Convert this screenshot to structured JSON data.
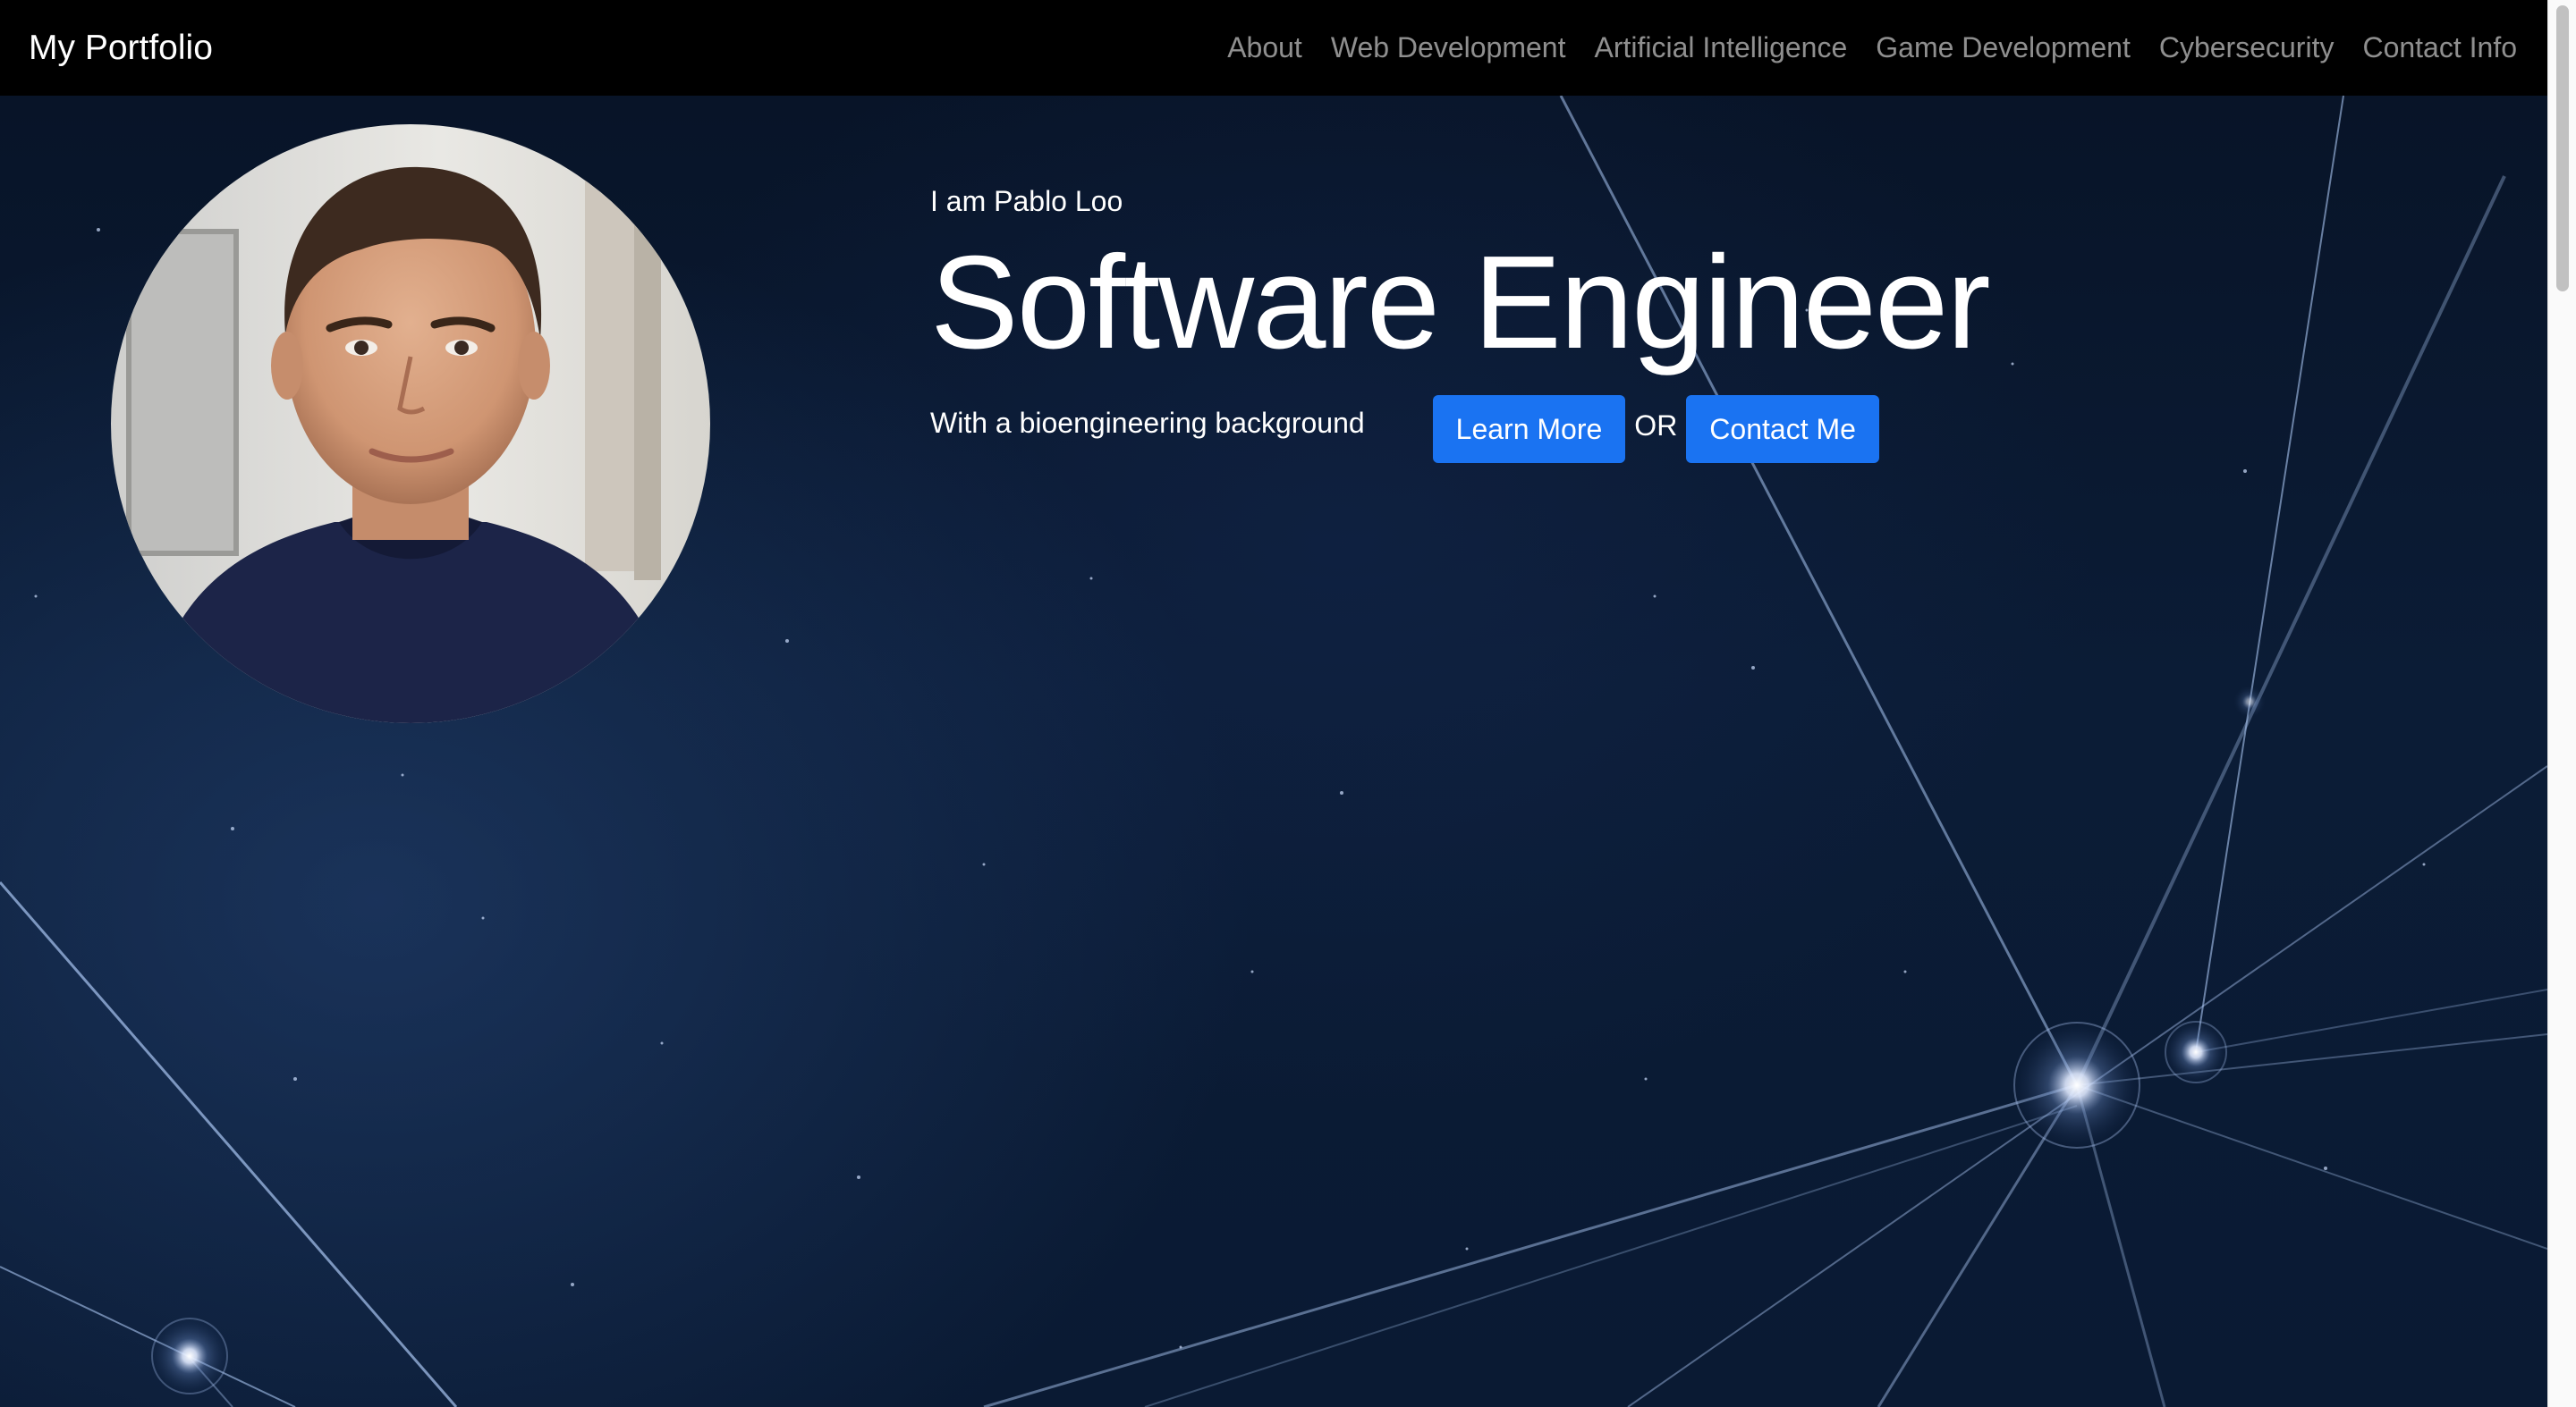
{
  "navbar": {
    "brand": "My Portfolio",
    "links": [
      "About",
      "Web Development",
      "Artificial Intelligence",
      "Game Development",
      "Cybersecurity",
      "Contact Info"
    ]
  },
  "hero": {
    "intro": "I am Pablo Loo",
    "headline": "Software Engineer",
    "tagline": "With a bioengineering background",
    "learn_more": "Learn More",
    "or": "OR",
    "contact_me": "Contact Me"
  },
  "colors": {
    "navbar_bg": "#000000",
    "button_bg": "#1a73f2",
    "nav_link": "rgba(255,255,255,0.56)"
  },
  "icons": {
    "avatar": "profile-photo"
  }
}
